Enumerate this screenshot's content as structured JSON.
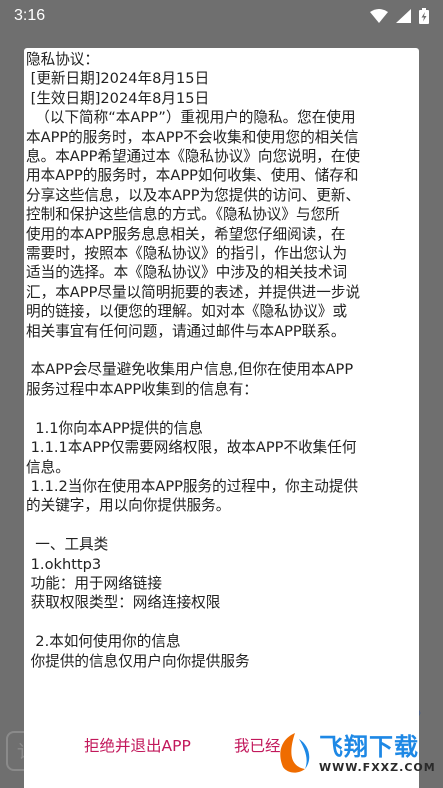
{
  "status_bar": {
    "time": "3:16",
    "icons": [
      "wifi-icon",
      "signal-icon",
      "battery-charging-icon"
    ]
  },
  "policy_lines": [
    "隐私协议：",
    " [更新日期]2024年8月15日",
    " [生效日期]2024年8月15日",
    "  （以下简称“本APP”）重视用户的隐私。您在使用",
    "本APP的服务时，本APP不会收集和使用您的相关信",
    "息。本APP希望通过本《隐私协议》向您说明，在使",
    "用本APP的服务时，本APP如何收集、使用、储存和",
    "分享这些信息，以及本APP为您提供的访问、更新、",
    "控制和保护这些信息的方式。《隐私协议》与您所",
    "使用的本APP服务息息相关，希望您仔细阅读，在",
    "需要时，按照本《隐私协议》的指引，作出您认为",
    "适当的选择。本《隐私协议》中涉及的相关技术词",
    "汇，本APP尽量以简明扼要的表述，并提供进一步说",
    "明的链接，以便您的理解。如对本《隐私协议》或",
    "相关事宜有任何问题，请通过邮件与本APP联系。",
    "",
    " 本APP会尽量避免收集用户信息,但你在使用本APP",
    "服务过程中本APP收集到的信息有：",
    "",
    "  1.1你向本APP提供的信息",
    " 1.1.1本APP仅需要网络权限，故本APP不收集任何",
    "信息。",
    " 1.1.2当你在使用本APP服务的过程中，你主动提供",
    "的关键字，用以向你提供服务。",
    "",
    "  一、工具类",
    " 1.okhttp3",
    " 功能：用于网络链接",
    " 获取权限类型：网络连接权限",
    "",
    "  2.本如何使用你的信息",
    " 你提供的信息仅用户向你提供服务"
  ],
  "buttons": {
    "reject": "拒绝并退出APP",
    "agree": "我已经"
  },
  "background": {
    "left_box_glyph": "讠",
    "right_arrow": "》"
  },
  "watermark": {
    "brand": "飞翔下载",
    "url": "WWW.FXXZ.COM"
  },
  "colors": {
    "accent": "#c2185b",
    "scrim": "#6f6f6f",
    "watermark_blue": "#1e88e5"
  }
}
